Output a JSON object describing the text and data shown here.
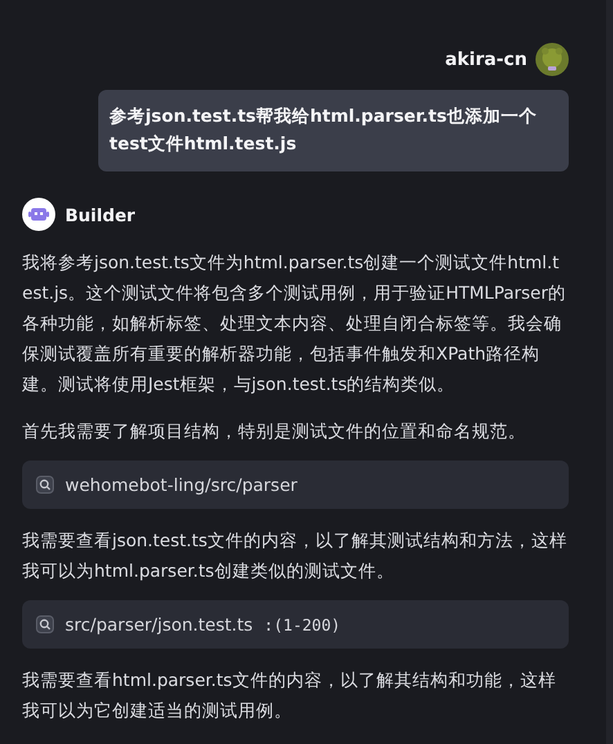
{
  "user": {
    "name": "akira-cn",
    "message": "参考json.test.ts帮我给html.parser.ts也添加一个test文件html.test.js"
  },
  "assistant": {
    "name": "Builder"
  },
  "blocks": [
    {
      "kind": "text",
      "text": "我将参考json.test.ts文件为html.parser.ts创建一个测试文件html.test.js。这个测试文件将包含多个测试用例，用于验证HTMLParser的各种功能，如解析标签、处理文本内容、处理自闭合标签等。我会确保测试覆盖所有重要的解析器功能，包括事件触发和XPath路径构建。测试将使用Jest框架，与json.test.ts的结构类似。"
    },
    {
      "kind": "text",
      "text": "首先我需要了解项目结构，特别是测试文件的位置和命名规范。"
    },
    {
      "kind": "search",
      "path": "wehomebot-ling/src/parser"
    },
    {
      "kind": "text",
      "text": "我需要查看json.test.ts文件的内容，以了解其测试结构和方法，这样我可以为html.parser.ts创建类似的测试文件。"
    },
    {
      "kind": "search",
      "path": "src/parser/json.test.ts",
      "range": ":(1-200)"
    },
    {
      "kind": "text",
      "text": "我需要查看html.parser.ts文件的内容，以了解其结构和功能，这样我可以为它创建适当的测试用例。"
    }
  ]
}
